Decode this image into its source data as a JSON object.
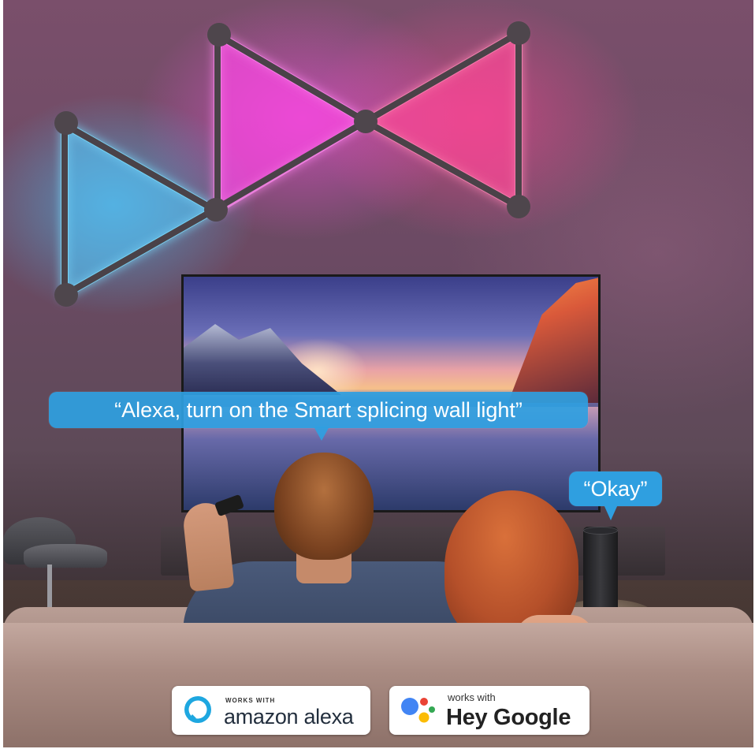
{
  "scene": {
    "voice_command": "“Alexa, turn on the Smart splicing wall light”",
    "assistant_reply": "“Okay”"
  },
  "badges": {
    "alexa": {
      "small_text": "WORKS WITH",
      "big_text": "amazon alexa",
      "icon": "alexa-ring-icon",
      "color": "#1ea7e0"
    },
    "google": {
      "small_text": "works with",
      "big_text": "Hey Google",
      "icon": "google-assistant-dots-icon",
      "colors": [
        "#4285f4",
        "#ea4335",
        "#fbbc05",
        "#34a853"
      ]
    }
  },
  "colors": {
    "bubble": "#2f9fe0",
    "light_cyan": "#46c8ff",
    "light_magenta": "#ff50e6",
    "light_pink": "#ff4696"
  }
}
